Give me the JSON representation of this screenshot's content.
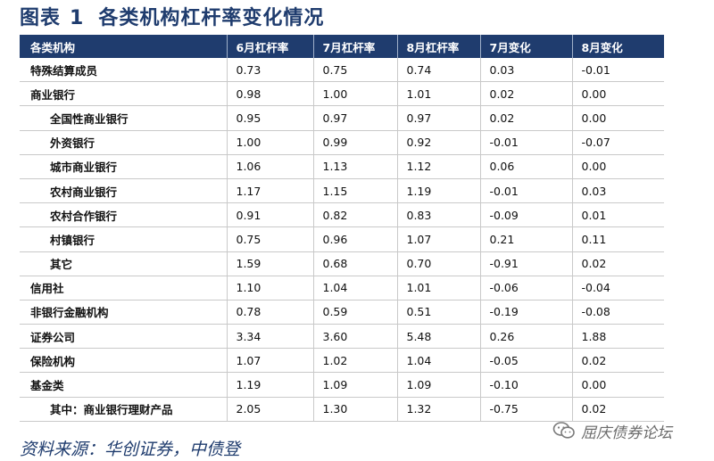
{
  "figure": {
    "label": "图表",
    "number": "1",
    "title": "各类机构杠杆率变化情况"
  },
  "table": {
    "headers": [
      "各类机构",
      "6月杠杆率",
      "7月杠杆率",
      "8月杠杆率",
      "7月变化",
      "8月变化"
    ],
    "rows": [
      {
        "name": "特殊结算成员",
        "sub": false,
        "values": [
          "0.73",
          "0.75",
          "0.74",
          "0.03",
          "-0.01"
        ]
      },
      {
        "name": "商业银行",
        "sub": false,
        "values": [
          "0.98",
          "1.00",
          "1.01",
          "0.02",
          "0.00"
        ]
      },
      {
        "name": "全国性商业银行",
        "sub": true,
        "values": [
          "0.95",
          "0.97",
          "0.97",
          "0.02",
          "0.00"
        ]
      },
      {
        "name": "外资银行",
        "sub": true,
        "values": [
          "1.00",
          "0.99",
          "0.92",
          "-0.01",
          "-0.07"
        ]
      },
      {
        "name": "城市商业银行",
        "sub": true,
        "values": [
          "1.06",
          "1.13",
          "1.12",
          "0.06",
          "0.00"
        ]
      },
      {
        "name": "农村商业银行",
        "sub": true,
        "values": [
          "1.17",
          "1.15",
          "1.19",
          "-0.01",
          "0.03"
        ]
      },
      {
        "name": "农村合作银行",
        "sub": true,
        "values": [
          "0.91",
          "0.82",
          "0.83",
          "-0.09",
          "0.01"
        ]
      },
      {
        "name": "村镇银行",
        "sub": true,
        "values": [
          "0.75",
          "0.96",
          "1.07",
          "0.21",
          "0.11"
        ]
      },
      {
        "name": "其它",
        "sub": true,
        "values": [
          "1.59",
          "0.68",
          "0.70",
          "-0.91",
          "0.02"
        ]
      },
      {
        "name": "信用社",
        "sub": false,
        "values": [
          "1.10",
          "1.04",
          "1.01",
          "-0.06",
          "-0.04"
        ]
      },
      {
        "name": "非银行金融机构",
        "sub": false,
        "values": [
          "0.78",
          "0.59",
          "0.51",
          "-0.19",
          "-0.08"
        ]
      },
      {
        "name": "证券公司",
        "sub": false,
        "values": [
          "3.34",
          "3.60",
          "5.48",
          "0.26",
          "1.88"
        ]
      },
      {
        "name": "保险机构",
        "sub": false,
        "values": [
          "1.07",
          "1.02",
          "1.04",
          "-0.05",
          "0.02"
        ]
      },
      {
        "name": "基金类",
        "sub": false,
        "values": [
          "1.19",
          "1.09",
          "1.09",
          "-0.10",
          "0.00"
        ]
      },
      {
        "name": "其中：商业银行理财产品",
        "sub": true,
        "values": [
          "2.05",
          "1.30",
          "1.32",
          "-0.75",
          "0.02"
        ]
      }
    ]
  },
  "source": "资料来源：华创证券，中债登",
  "watermark": {
    "text": "屈庆债券论坛",
    "icon": "wechat-icon"
  },
  "colors": {
    "header_bg": "#1f3c6e",
    "title": "#1f3c6e"
  }
}
